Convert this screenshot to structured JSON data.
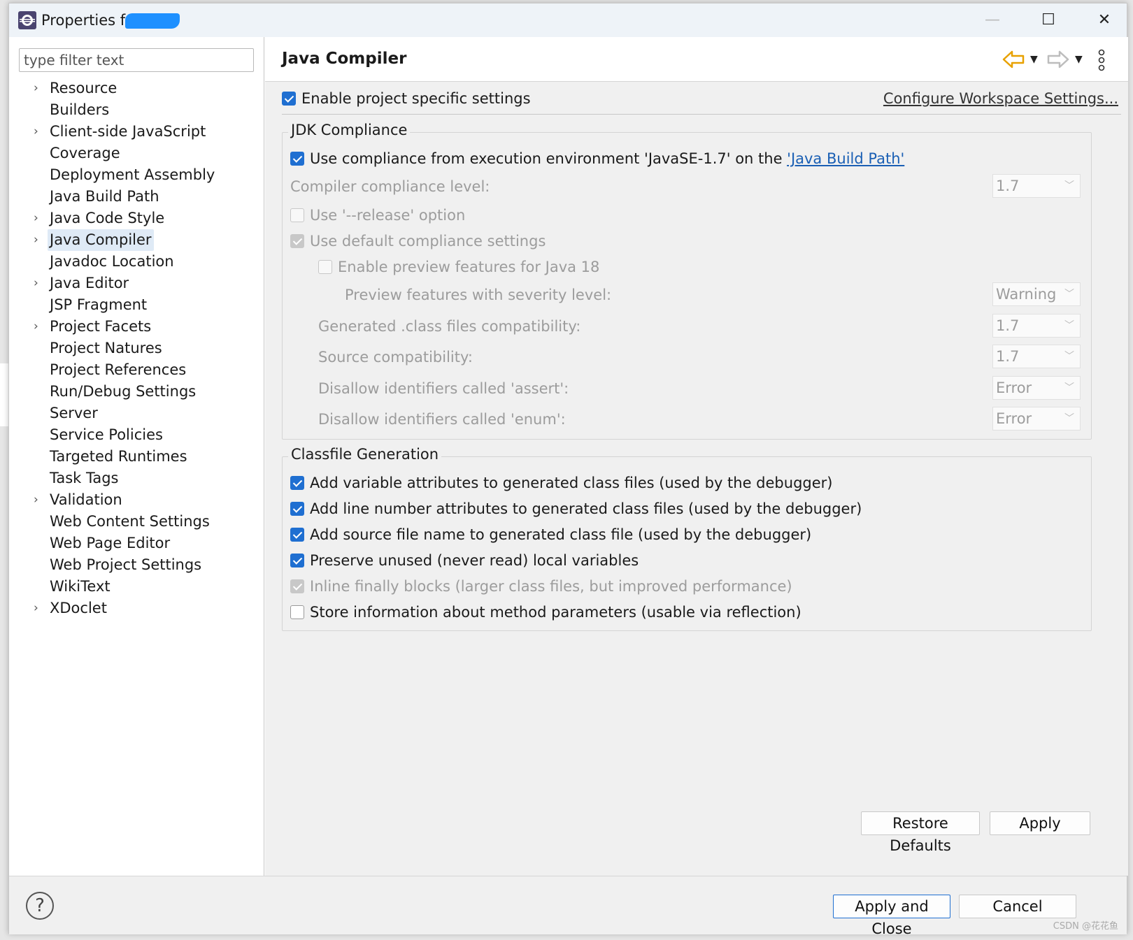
{
  "window": {
    "title": "Properties for",
    "min_label": "—",
    "max_label": "☐",
    "close_label": "✕"
  },
  "sidebar": {
    "filter_placeholder": "type filter text",
    "items": [
      {
        "label": "Resource",
        "expandable": true
      },
      {
        "label": "Builders",
        "expandable": false
      },
      {
        "label": "Client-side JavaScript",
        "expandable": true
      },
      {
        "label": "Coverage",
        "expandable": false
      },
      {
        "label": "Deployment Assembly",
        "expandable": false
      },
      {
        "label": "Java Build Path",
        "expandable": false
      },
      {
        "label": "Java Code Style",
        "expandable": true
      },
      {
        "label": "Java Compiler",
        "expandable": true,
        "selected": true
      },
      {
        "label": "Javadoc Location",
        "expandable": false
      },
      {
        "label": "Java Editor",
        "expandable": true
      },
      {
        "label": "JSP Fragment",
        "expandable": false
      },
      {
        "label": "Project Facets",
        "expandable": true
      },
      {
        "label": "Project Natures",
        "expandable": false
      },
      {
        "label": "Project References",
        "expandable": false
      },
      {
        "label": "Run/Debug Settings",
        "expandable": false
      },
      {
        "label": "Server",
        "expandable": false
      },
      {
        "label": "Service Policies",
        "expandable": false
      },
      {
        "label": "Targeted Runtimes",
        "expandable": false
      },
      {
        "label": "Task Tags",
        "expandable": false
      },
      {
        "label": "Validation",
        "expandable": true
      },
      {
        "label": "Web Content Settings",
        "expandable": false
      },
      {
        "label": "Web Page Editor",
        "expandable": false
      },
      {
        "label": "Web Project Settings",
        "expandable": false
      },
      {
        "label": "WikiText",
        "expandable": false
      },
      {
        "label": "XDoclet",
        "expandable": true
      }
    ]
  },
  "page": {
    "title": "Java Compiler",
    "enable_project_specific": "Enable project specific settings",
    "configure_workspace": "Configure Workspace Settings...",
    "jdk": {
      "title": "JDK Compliance",
      "use_compliance_prefix": "Use compliance from execution environment 'JavaSE-1.7' on the ",
      "use_compliance_link": "'Java Build Path'",
      "compliance_level_label": "Compiler compliance level:",
      "compliance_level_value": "1.7",
      "release_option": "Use '--release' option",
      "default_compliance": "Use default compliance settings",
      "enable_preview": "Enable preview features for Java 18",
      "preview_severity_label": "Preview features with severity level:",
      "preview_severity_value": "Warning",
      "generated_compat_label": "Generated .class files compatibility:",
      "generated_compat_value": "1.7",
      "source_compat_label": "Source compatibility:",
      "source_compat_value": "1.7",
      "disallow_assert_label": "Disallow identifiers called 'assert':",
      "disallow_assert_value": "Error",
      "disallow_enum_label": "Disallow identifiers called 'enum':",
      "disallow_enum_value": "Error"
    },
    "classfile": {
      "title": "Classfile Generation",
      "variable_attrs": "Add variable attributes to generated class files (used by the debugger)",
      "line_number_attrs": "Add line number attributes to generated class files (used by the debugger)",
      "source_file_name": "Add source file name to generated class file (used by the debugger)",
      "preserve_unused": "Preserve unused (never read) local variables",
      "inline_finally": "Inline finally blocks (larger class files, but improved performance)",
      "store_method_params": "Store information about method parameters (usable via reflection)"
    },
    "restore_defaults": "Restore Defaults",
    "apply": "Apply"
  },
  "footer": {
    "help_label": "?",
    "apply_and_close": "Apply and Close",
    "cancel": "Cancel",
    "watermark": "CSDN @花花鱼"
  },
  "colors": {
    "accent": "#1f6fd1",
    "link": "#1a5fb4",
    "back_arrow": "#e8a100"
  }
}
